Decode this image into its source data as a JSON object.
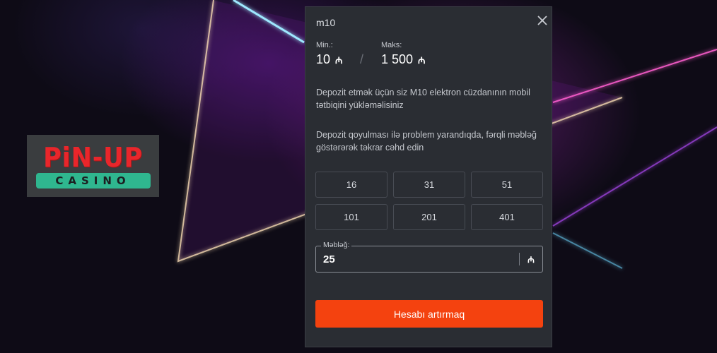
{
  "brand": {
    "logo_main": "PiN-UP",
    "logo_sub": "CASINO",
    "logo_red": "#e9262b",
    "logo_green": "#2fb78f"
  },
  "modal": {
    "title": "m10",
    "close_icon": "close-icon",
    "limits": {
      "min_label": "Min.:",
      "min_value": "10",
      "max_label": "Maks:",
      "max_value": "1 500",
      "separator": "/",
      "currency": "₼"
    },
    "info_1": "Depozit etmək üçün siz M10 elektron cüzdanının mobil tətbiqini yükləməlisiniz",
    "info_2": "Depozit qoyulması ilə problem yarandıqda, fərqli məbləğ göstərərək təkrar cəhd edin",
    "amounts": [
      "16",
      "31",
      "51",
      "101",
      "201",
      "401"
    ],
    "amount_field": {
      "label": "Məbləğ:",
      "value": "25",
      "currency": "₼"
    },
    "submit_label": "Hesabı artırmaq",
    "accent_color": "#f4420f",
    "panel_color": "#2a2d33"
  }
}
